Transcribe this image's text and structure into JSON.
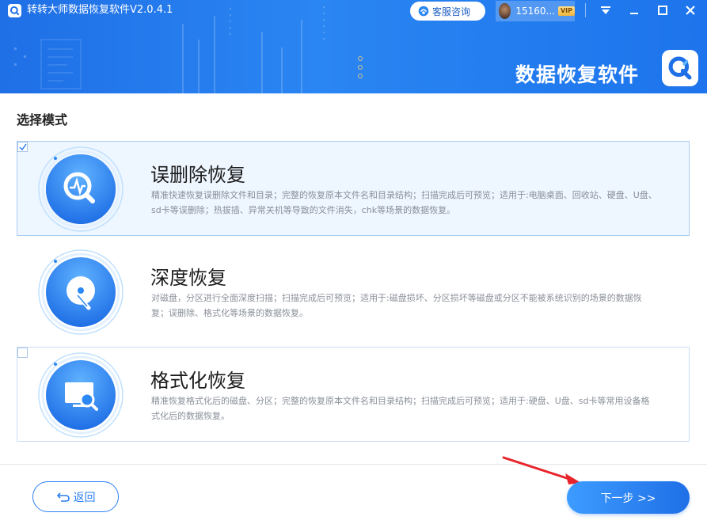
{
  "window": {
    "title": "转转大师数据恢复软件V2.0.4.1",
    "support_label": "客服咨询",
    "user_name": "15160...",
    "vip_label": "VIP",
    "brand_text": "数据恢复软件"
  },
  "section_title": "选择模式",
  "modes": [
    {
      "title": "误删除恢复",
      "desc": "精准快速恢复误删除文件和目录；完整的恢复原本文件名和目录结构；扫描完成后可预览；适用于:电脑桌面、回收站、硬盘、U盘、sd卡等误删除；热拔插、异常关机等导致的文件消失，chk等场景的数据恢复。",
      "selected": true,
      "icon": "magnifier-pulse-icon"
    },
    {
      "title": "深度恢复",
      "desc": "对磁盘，分区进行全面深度扫描；扫描完成后可预览；适用于:磁盘损坏、分区损坏等磁盘或分区不能被系统识别的场景的数据恢复；误删除、格式化等场景的数据恢复。",
      "selected": false,
      "icon": "disk-icon"
    },
    {
      "title": "格式化恢复",
      "desc": "精准恢复格式化后的磁盘、分区；完整的恢复原本文件名和目录结构；扫描完成后可预览；适用于:硬盘、U盘、sd卡等常用设备格式化后的数据恢复。",
      "selected": false,
      "icon": "monitor-search-icon"
    }
  ],
  "footer": {
    "back_label": "返回",
    "next_label": "下一步 >>"
  },
  "colors": {
    "accent": "#1f6fe6",
    "header": "#2a86f2"
  }
}
